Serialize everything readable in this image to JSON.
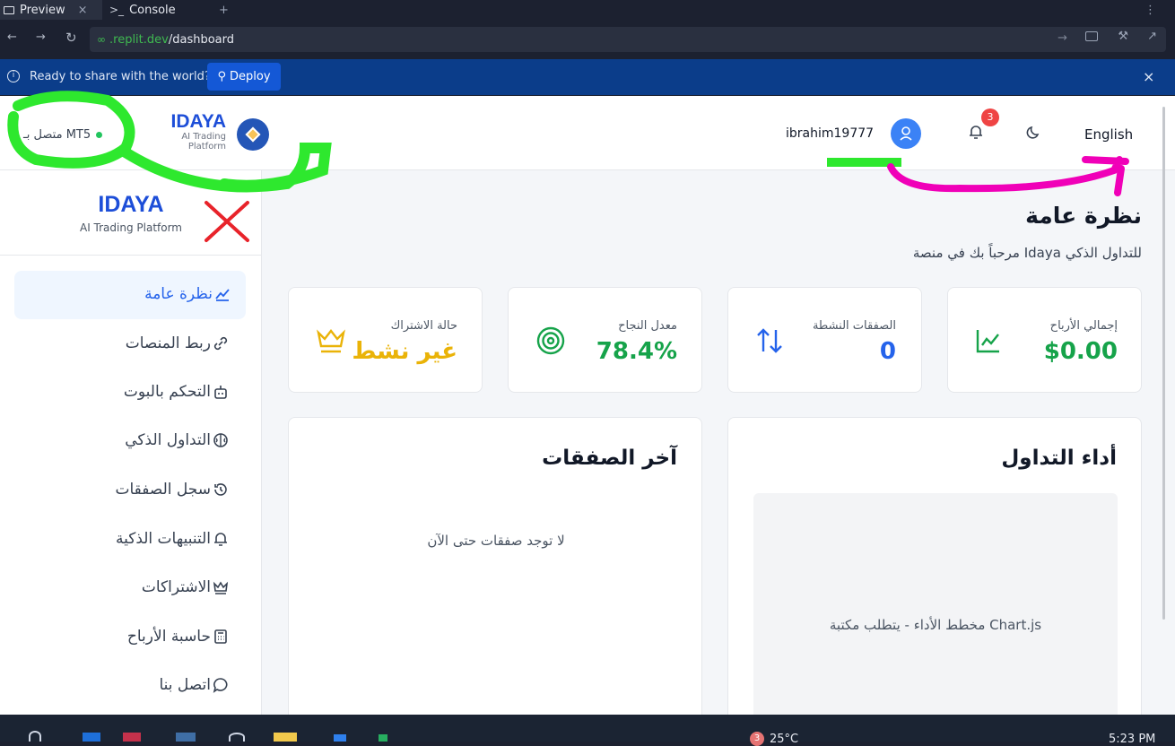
{
  "browser": {
    "tabs": [
      {
        "label": "Preview"
      },
      {
        "label": "Console"
      }
    ],
    "url": {
      "domain": ".replit.dev",
      "path": "/dashboard"
    }
  },
  "banner": {
    "message": "Ready to share with the world?",
    "deploy_label": "Deploy"
  },
  "header": {
    "connection_status": "متصل بـ MT5",
    "brand": "IDAYA",
    "brand_sub_1": "AI Trading",
    "brand_sub_2": "Platform",
    "username": "ibrahim19777",
    "notification_count": "3",
    "language": "English"
  },
  "sidebar": {
    "brand": "IDAYA",
    "tagline": "AI Trading Platform",
    "items": [
      {
        "label": "نظرة عامة"
      },
      {
        "label": "ربط المنصات"
      },
      {
        "label": "التحكم بالبوت"
      },
      {
        "label": "التداول الذكي"
      },
      {
        "label": "سجل الصفقات"
      },
      {
        "label": "التنبيهات الذكية"
      },
      {
        "label": "الاشتراكات"
      },
      {
        "label": "حاسبة الأرباح"
      },
      {
        "label": "اتصل بنا"
      }
    ]
  },
  "main": {
    "title": "نظرة عامة",
    "subtitle": "مرحباً بك في منصة Idaya للتداول الذكي",
    "stats": [
      {
        "label": "إجمالي الأرباح",
        "value": "$0.00",
        "color": "#16a34a"
      },
      {
        "label": "الصفقات النشطة",
        "value": "0",
        "color": "#2563eb"
      },
      {
        "label": "معدل النجاح",
        "value": "78.4%",
        "color": "#16a34a"
      },
      {
        "label": "حالة الاشتراك",
        "value": "غير نشط",
        "color": "#eab308"
      }
    ],
    "performance": {
      "title": "أداء التداول",
      "placeholder": "مخطط الأداء - يتطلب مكتبة Chart.js"
    },
    "recent_trades": {
      "title": "آخر الصفقات",
      "empty": "لا توجد صفقات حتى الآن"
    }
  },
  "taskbar": {
    "weather_badge": "3",
    "temperature": "25°C",
    "time": "5:23 PM"
  }
}
